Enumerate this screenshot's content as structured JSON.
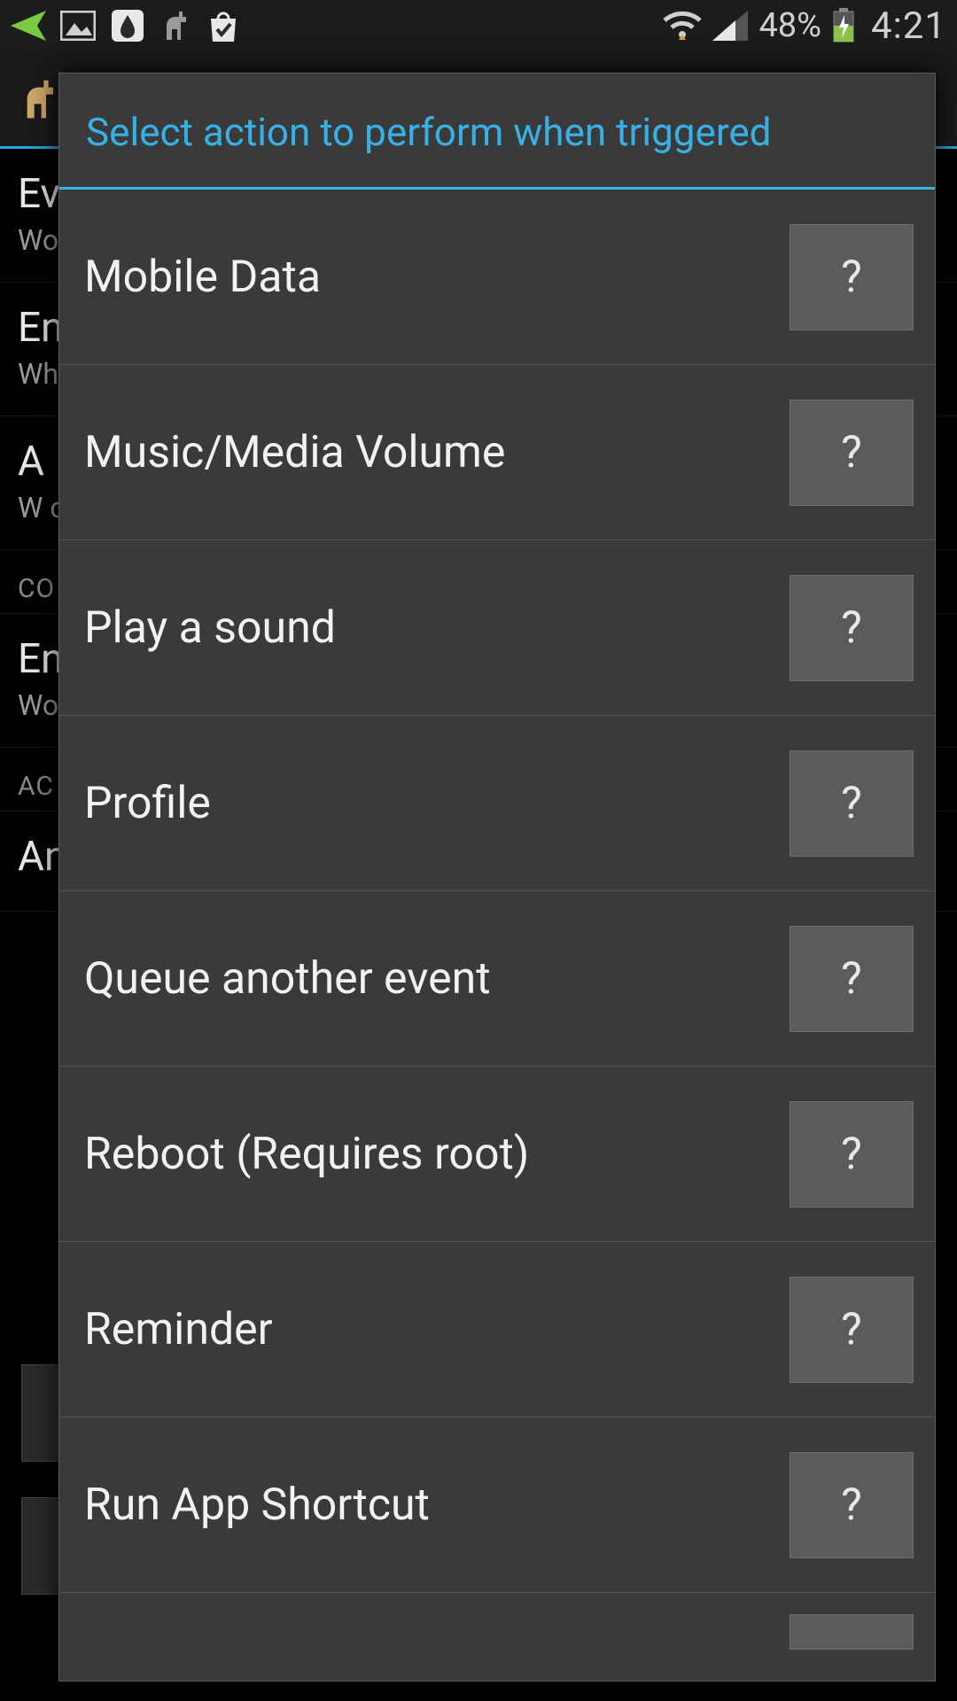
{
  "status": {
    "battery_pct": "48%",
    "time": "4:21"
  },
  "background": {
    "rows": [
      {
        "t1": "Ev",
        "t2": "Wo"
      },
      {
        "t1": "En",
        "t2": "Wh\nand"
      },
      {
        "t1": "A",
        "t2": "W\nco"
      }
    ],
    "section1": "CO",
    "row4_t1": "En",
    "row4_t2": "Wo",
    "section2": "AC",
    "row5_t1": "An"
  },
  "dialog": {
    "title": "Select action to perform when triggered",
    "help_label": "?",
    "actions": [
      "Mobile Data",
      "Music/Media Volume",
      "Play a sound",
      "Profile",
      "Queue another event",
      "Reboot (Requires root)",
      "Reminder",
      "Run App Shortcut"
    ]
  }
}
